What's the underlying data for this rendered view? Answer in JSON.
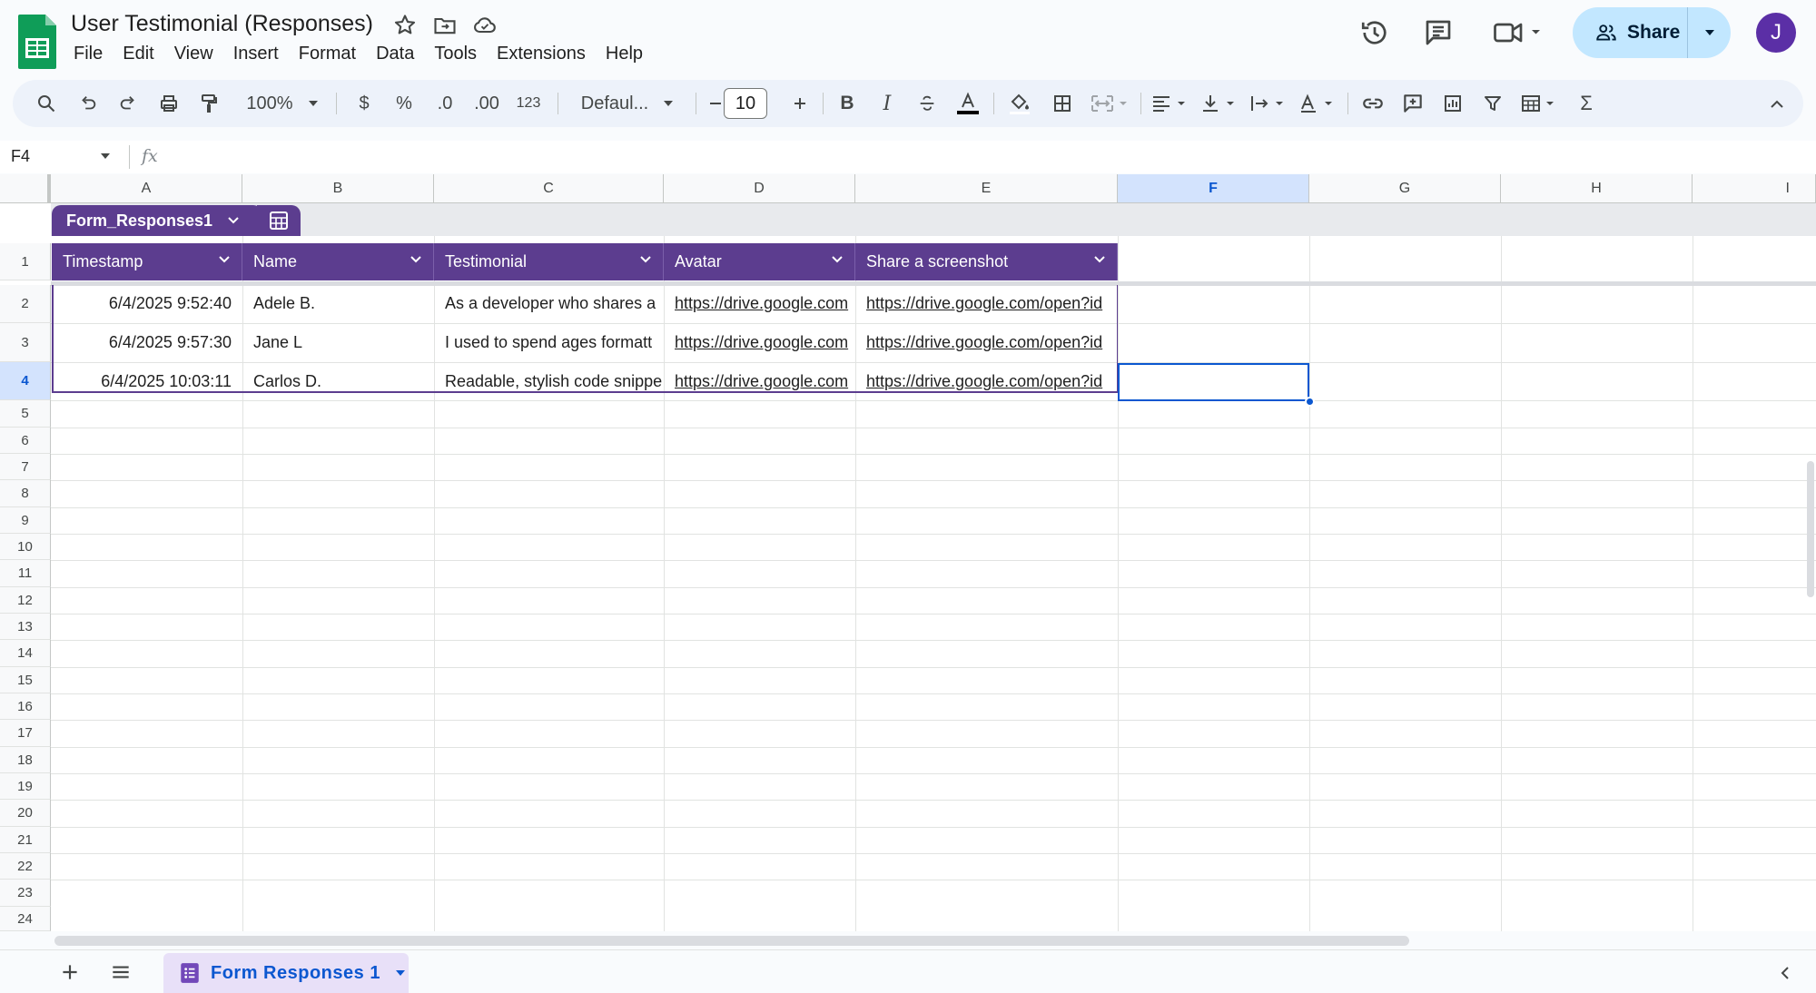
{
  "doc": {
    "title": "User Testimonial (Responses)"
  },
  "menu": [
    "File",
    "Edit",
    "View",
    "Insert",
    "Format",
    "Data",
    "Tools",
    "Extensions",
    "Help"
  ],
  "share": {
    "label": "Share"
  },
  "user": {
    "initial": "J"
  },
  "toolbar": {
    "zoom": "100%",
    "currency": "$",
    "percent": "%",
    "decrease_decimal": ".0",
    "increase_decimal": ".00",
    "number_format": "123",
    "font": "Defaul...",
    "font_size": "10"
  },
  "formula": {
    "name_box": "F4",
    "fx": "fx",
    "value": ""
  },
  "columns": [
    "A",
    "B",
    "C",
    "D",
    "E",
    "F",
    "G",
    "H",
    "I"
  ],
  "selected_column": "F",
  "rows": [
    "1",
    "2",
    "3",
    "4",
    "5",
    "6",
    "7",
    "8",
    "9",
    "10",
    "11",
    "12",
    "13",
    "14",
    "15",
    "16",
    "17",
    "18",
    "19",
    "20",
    "21",
    "22",
    "23",
    "24"
  ],
  "selected_row": "4",
  "table": {
    "name": "Form_Responses1",
    "headers": [
      "Timestamp",
      "Name",
      "Testimonial",
      "Avatar",
      "Share a screenshot"
    ],
    "records": [
      [
        "6/4/2025 9:52:40",
        "Adele B.",
        "As a developer who shares a",
        "https://drive.google.com",
        "https://drive.google.com/open?id"
      ],
      [
        "6/4/2025 9:57:30",
        "Jane L",
        "I used to spend ages formatt",
        "https://drive.google.com",
        "https://drive.google.com/open?id"
      ],
      [
        "6/4/2025 10:03:11",
        "Carlos D.",
        "Readable, stylish code snippe",
        "https://drive.google.com",
        "https://drive.google.com/open?id"
      ]
    ]
  },
  "sheet_tab": {
    "label": "Form Responses 1"
  },
  "colors": {
    "table_header": "#5c3d8f",
    "share_bg": "#c2e7ff",
    "selection": "#0b57d0",
    "logo_green": "#0f9d58",
    "avatar": "#5b2fa6"
  }
}
